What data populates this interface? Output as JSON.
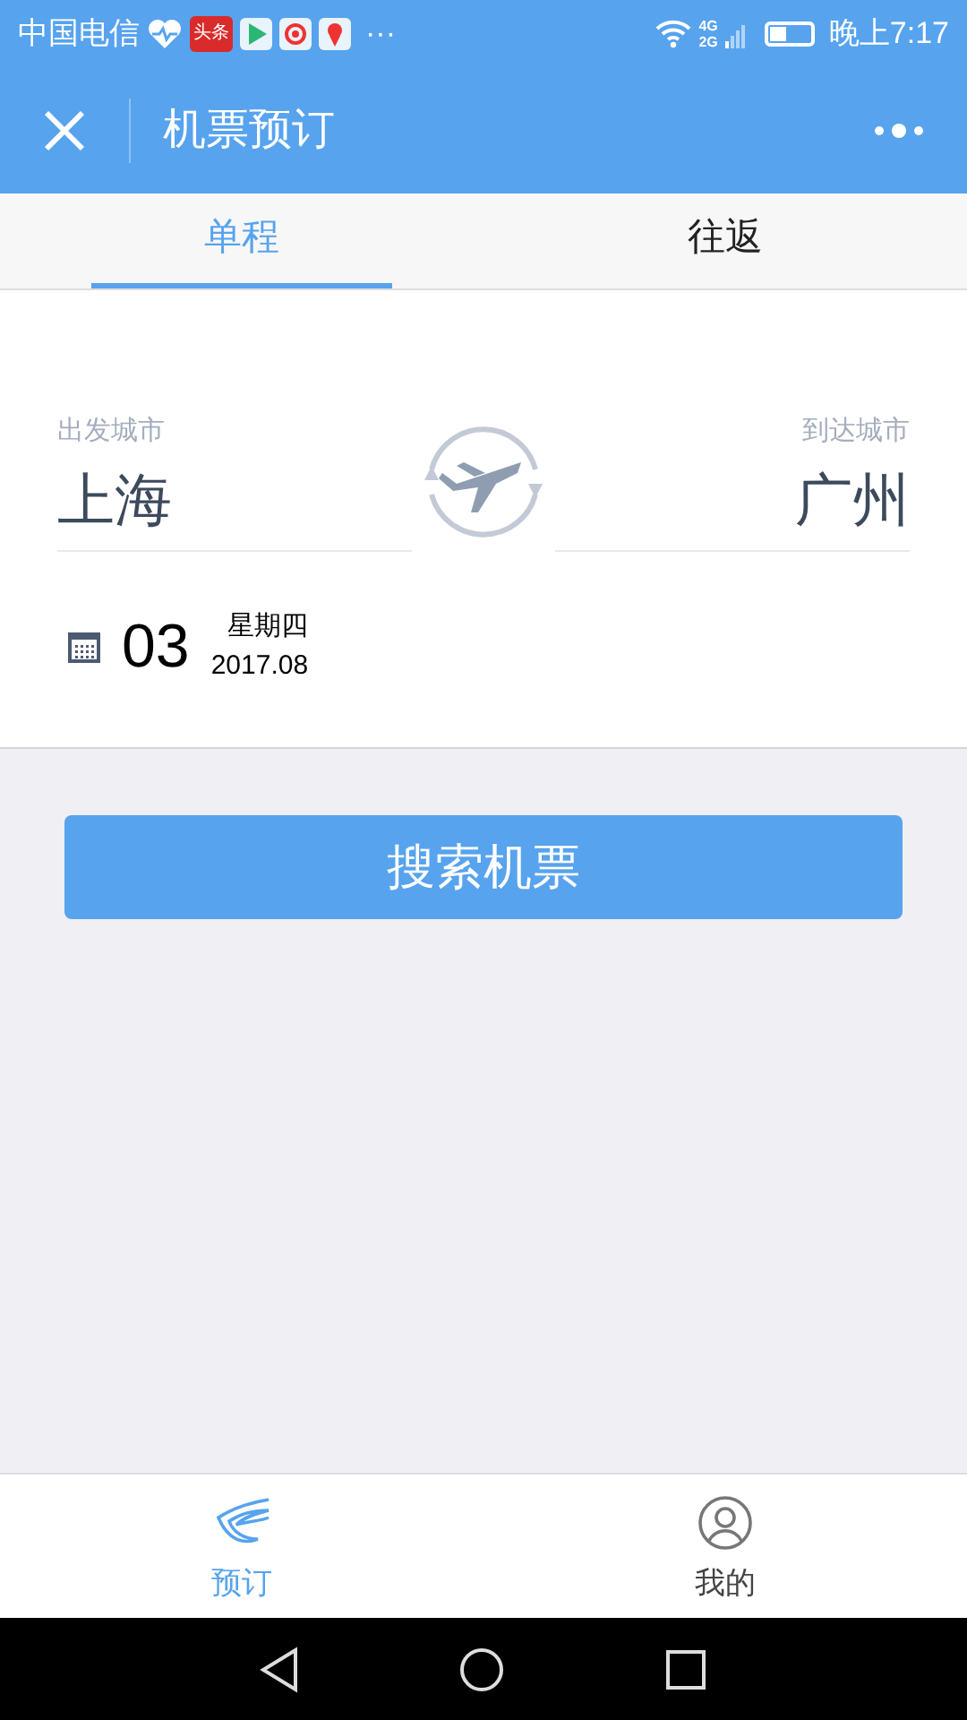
{
  "status_bar": {
    "carrier": "中国电信",
    "app_badge": "头条",
    "more": "···",
    "network_top": "4G",
    "network_bottom": "2G",
    "time": "晚上7:17"
  },
  "header": {
    "title": "机票预订"
  },
  "tabs": [
    {
      "label": "单程",
      "selected": true
    },
    {
      "label": "往返",
      "selected": false
    }
  ],
  "trip": {
    "from_label": "出发城市",
    "from_city": "上海",
    "to_label": "到达城市",
    "to_city": "广州",
    "day": "03",
    "weekday": "星期四",
    "month": "2017.08"
  },
  "search_button": "搜索机票",
  "bottom_tabs": [
    {
      "label": "预订",
      "kind": "booking",
      "selected": true
    },
    {
      "label": "我的",
      "kind": "profile",
      "selected": false
    }
  ]
}
